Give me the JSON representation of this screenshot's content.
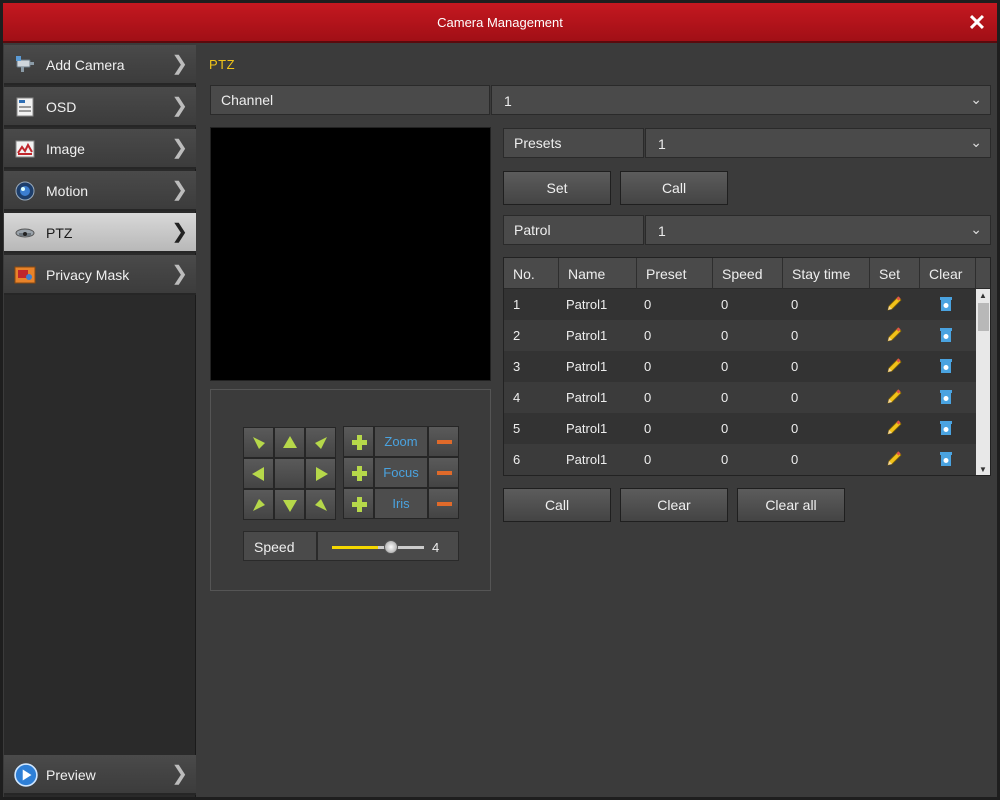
{
  "window": {
    "title": "Camera Management"
  },
  "sidebar": {
    "items": [
      {
        "label": "Add Camera",
        "icon": "camera-icon"
      },
      {
        "label": "OSD",
        "icon": "osd-icon"
      },
      {
        "label": "Image",
        "icon": "image-icon"
      },
      {
        "label": "Motion",
        "icon": "motion-icon"
      },
      {
        "label": "PTZ",
        "icon": "ptz-camera-icon",
        "active": true
      },
      {
        "label": "Privacy Mask",
        "icon": "privacy-mask-icon"
      }
    ],
    "preview": {
      "label": "Preview",
      "icon": "play-icon"
    }
  },
  "main": {
    "section_title": "PTZ",
    "channel": {
      "label": "Channel",
      "value": "1"
    },
    "presets": {
      "label": "Presets",
      "value": "1",
      "set_label": "Set",
      "call_label": "Call"
    },
    "patrol": {
      "label": "Patrol",
      "value": "1"
    },
    "ptz": {
      "zoom_label": "Zoom",
      "focus_label": "Focus",
      "iris_label": "Iris",
      "speed_label": "Speed",
      "speed_value": "4",
      "speed_fraction": 0.5
    },
    "table": {
      "headers": [
        "No.",
        "Name",
        "Preset",
        "Speed",
        "Stay time",
        "Set",
        "Clear"
      ],
      "rows": [
        [
          "1",
          "Patrol1",
          "0",
          "0",
          "0"
        ],
        [
          "2",
          "Patrol1",
          "0",
          "0",
          "0"
        ],
        [
          "3",
          "Patrol1",
          "0",
          "0",
          "0"
        ],
        [
          "4",
          "Patrol1",
          "0",
          "0",
          "0"
        ],
        [
          "5",
          "Patrol1",
          "0",
          "0",
          "0"
        ],
        [
          "6",
          "Patrol1",
          "0",
          "0",
          "0"
        ]
      ]
    },
    "bottom_buttons": {
      "call_label": "Call",
      "clear_label": "Clear",
      "clear_all_label": "Clear all"
    }
  },
  "colors": {
    "title_bar": "#c41820",
    "accent_yellow": "#f0c419",
    "ptz_arrow": "#b6d84a",
    "plus": "#b6d84a",
    "minus": "#e06a2a",
    "label_blue": "#4aa3e0"
  }
}
